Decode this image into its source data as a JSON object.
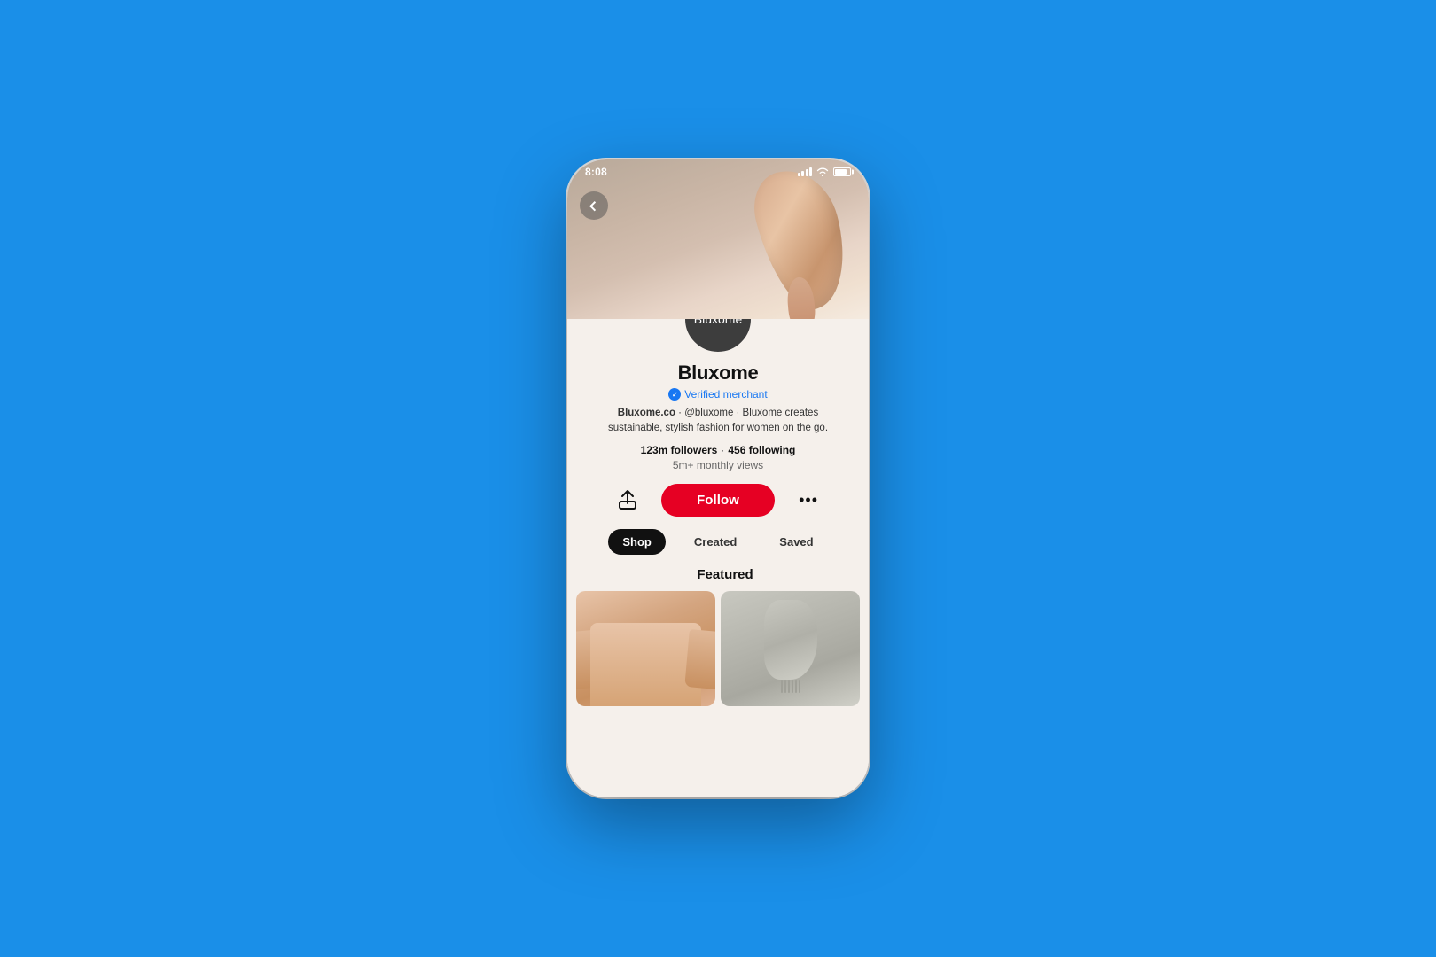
{
  "background_color": "#1a8fe8",
  "phone": {
    "status_bar": {
      "time": "8:08",
      "signal_label": "signal bars",
      "wifi_label": "wifi icon",
      "battery_label": "battery icon"
    },
    "cover": {
      "alt": "Fashion cover photo with draped scarf"
    },
    "back_button_label": "‹",
    "avatar": {
      "text": "Bluxome",
      "bg_color": "#3d3d3d"
    },
    "profile": {
      "name": "Bluxome",
      "verified_label": "✓",
      "verified_text": "Verified merchant",
      "bio": "Bluxome.co · @bluxome · Bluxome creates sustainable, stylish fashion for women on the go.",
      "bio_bold": "Bluxome.co",
      "followers": "123m followers",
      "following": "456 following",
      "monthly_views": "5m+ monthly views"
    },
    "actions": {
      "share_icon": "↑",
      "follow_label": "Follow",
      "more_icon": "•••"
    },
    "tabs": [
      {
        "label": "Shop",
        "active": true
      },
      {
        "label": "Created",
        "active": false
      },
      {
        "label": "Saved",
        "active": false
      }
    ],
    "featured_label": "Featured",
    "featured_images": [
      {
        "alt": "Peach knit sweater",
        "type": "sweater"
      },
      {
        "alt": "Grey scarf with fringe",
        "type": "scarf"
      }
    ]
  }
}
